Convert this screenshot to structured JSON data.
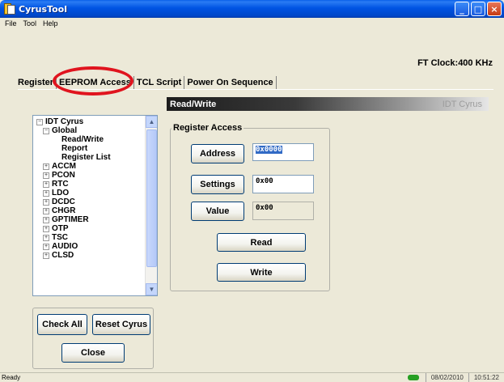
{
  "window": {
    "title": "CyrusTool",
    "minimize_glyph": "_",
    "maximize_glyph": "□",
    "close_glyph": "×"
  },
  "menu": {
    "items": [
      "File",
      "Tool",
      "Help"
    ]
  },
  "clock": "FT Clock:400 KHz",
  "tabs": [
    {
      "label": "Register",
      "active": true
    },
    {
      "label": "EEPROM Access",
      "active": false
    },
    {
      "label": "TCL Script",
      "active": false
    },
    {
      "label": "Power On Sequence",
      "active": false
    }
  ],
  "panel_header": {
    "title": "Read/Write",
    "brand": "IDT Cyrus"
  },
  "tree": {
    "items": [
      {
        "label": "IDT Cyrus",
        "expander": "−"
      },
      {
        "label": "Global",
        "expander": "−"
      },
      {
        "label": "Read/Write",
        "expander": ""
      },
      {
        "label": "Report",
        "expander": ""
      },
      {
        "label": "Register List",
        "expander": ""
      },
      {
        "label": "ACCM",
        "expander": "+"
      },
      {
        "label": "PCON",
        "expander": "+"
      },
      {
        "label": "RTC",
        "expander": "+"
      },
      {
        "label": "LDO",
        "expander": "+"
      },
      {
        "label": "DCDC",
        "expander": "+"
      },
      {
        "label": "CHGR",
        "expander": "+"
      },
      {
        "label": "GPTIMER",
        "expander": "+"
      },
      {
        "label": "OTP",
        "expander": "+"
      },
      {
        "label": "TSC",
        "expander": "+"
      },
      {
        "label": "AUDIO",
        "expander": "+"
      },
      {
        "label": "CLSD",
        "expander": "+"
      }
    ],
    "selected": "Read/Write",
    "scroll_up_glyph": "▲",
    "scroll_down_glyph": "▼"
  },
  "register_access": {
    "legend": "Register Access",
    "address_label": "Address",
    "address_value": "0x0000",
    "settings_label": "Settings",
    "settings_value": "0x00",
    "value_label": "Value",
    "value_value": "0x00",
    "read_label": "Read",
    "write_label": "Write"
  },
  "bottom": {
    "check_all": "Check All",
    "reset_cyrus": "Reset Cyrus",
    "close": "Close"
  },
  "status": {
    "text": "Ready",
    "date": "08/02/2010",
    "time": "10:51:22"
  },
  "colors": {
    "annotation_circle": "#e0141e",
    "online_indicator": "#27a023"
  }
}
